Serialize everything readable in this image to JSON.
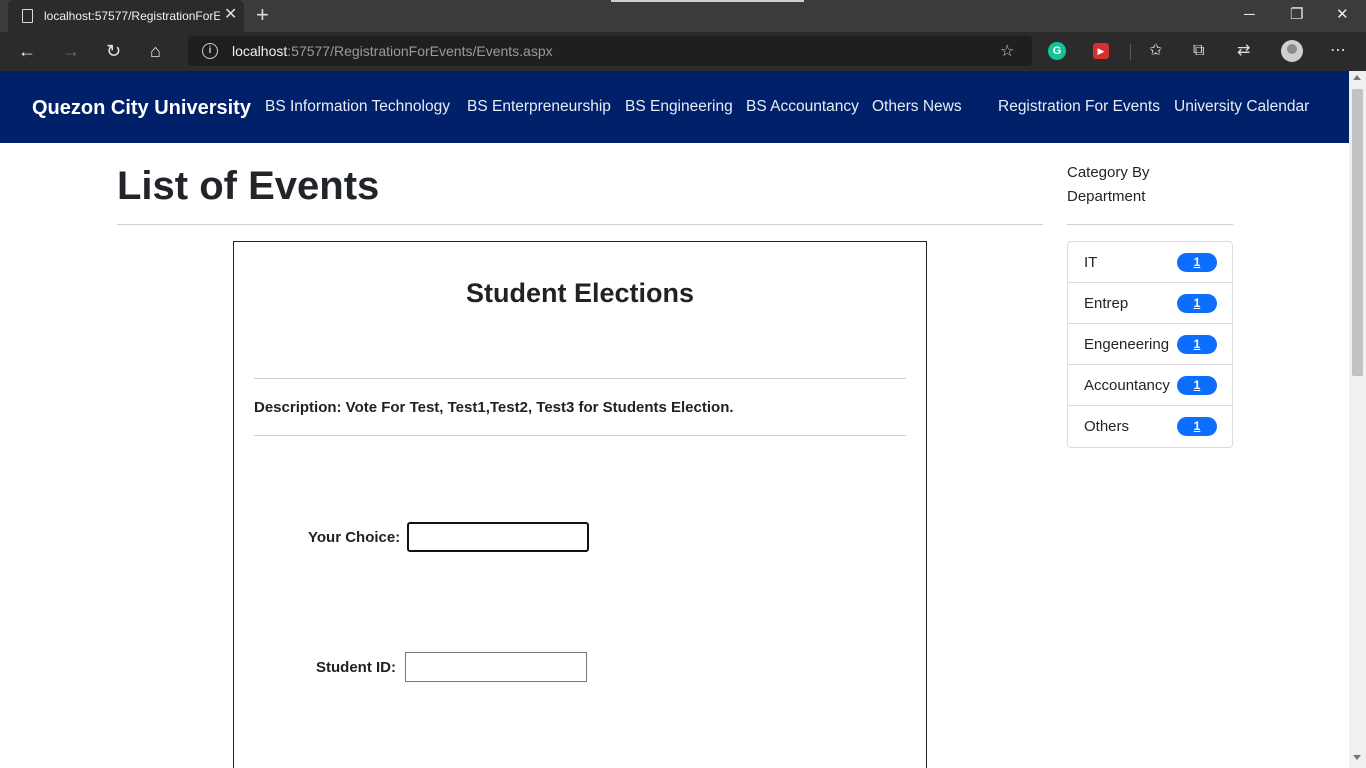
{
  "browser": {
    "tab_title": "localhost:57577/RegistrationForEvents/Events.aspx",
    "url_host": "localhost",
    "url_rest": ":57577/RegistrationForEvents/Events.aspx",
    "extension_g_label": "G"
  },
  "navbar": {
    "brand": "Quezon City University",
    "links": [
      "BS Information Technology",
      "BS Enterpreneurship",
      "BS Engineering",
      "BS Accountancy",
      "Others News",
      "Registration For Events",
      "University Calendar"
    ]
  },
  "main": {
    "page_title": "List of Events",
    "event": {
      "title": "Student Elections",
      "description": "Description: Vote For Test, Test1,Test2, Test3 for Students Election.",
      "choice_label": "Your Choice:",
      "choice_value": "",
      "student_id_label": "Student ID:",
      "student_id_value": ""
    }
  },
  "sidebar": {
    "heading_line1": "Category By",
    "heading_line2": "Department",
    "categories": [
      {
        "name": "IT",
        "count": "1"
      },
      {
        "name": "Entrep",
        "count": "1"
      },
      {
        "name": "Engeneering",
        "count": "1"
      },
      {
        "name": "Accountancy",
        "count": "1"
      },
      {
        "name": "Others",
        "count": "1"
      }
    ]
  },
  "colors": {
    "navbar": "#00216a",
    "badge": "#0d6efd"
  }
}
